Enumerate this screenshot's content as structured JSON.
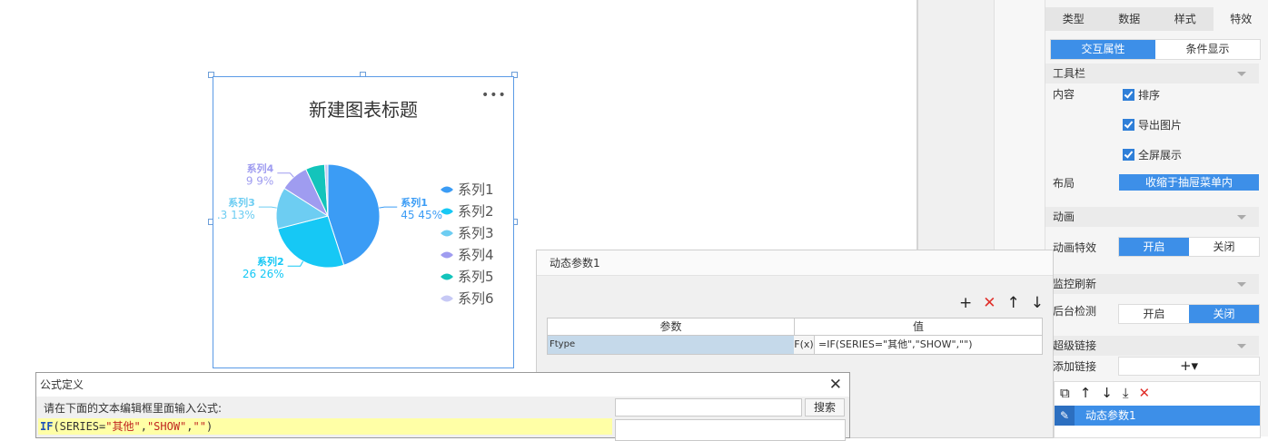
{
  "chart": {
    "title": "新建图表标题",
    "more_glyph": "•••"
  },
  "chart_data": {
    "type": "pie",
    "title": "新建图表标题",
    "series": [
      {
        "name": "系列1",
        "value": 45,
        "percent": "45%",
        "color": "#3b9cf5",
        "label": "系列1",
        "label_value": "45  45%"
      },
      {
        "name": "系列2",
        "value": 26,
        "percent": "26%",
        "color": "#16c8f5",
        "label": "系列2",
        "label_value": "26  26%"
      },
      {
        "name": "系列3",
        "value": 13,
        "percent": "13%",
        "color": "#6dcdf2",
        "label": "系列3",
        "label_value": ".3  13%"
      },
      {
        "name": "系列4",
        "value": 9,
        "percent": "9%",
        "color": "#9f9cf0",
        "label": "系列4",
        "label_value": "9  9%"
      },
      {
        "name": "系列5",
        "value": 6,
        "percent": "6%",
        "color": "#13c4bb",
        "label": "",
        "label_value": ""
      },
      {
        "name": "系列6",
        "value": 1,
        "percent": "1%",
        "color": "#c7c9f5",
        "label": "",
        "label_value": ""
      }
    ],
    "legend": [
      "系列1",
      "系列2",
      "系列3",
      "系列4",
      "系列5",
      "系列6"
    ],
    "legend_position": "right"
  },
  "props": {
    "tabs": [
      "类型",
      "数据",
      "样式",
      "特效"
    ],
    "subtabs": [
      "交互属性",
      "条件显示"
    ],
    "toolbar": {
      "section": "工具栏",
      "content_label": "内容",
      "checks": [
        "排序",
        "导出图片",
        "全屏展示"
      ],
      "layout_label": "布局",
      "layout_value": "收缩于抽屉菜单内"
    },
    "animation": {
      "section": "动画",
      "label": "动画特效",
      "on": "开启",
      "off": "关闭"
    },
    "monitor": {
      "section": "监控刷新",
      "label": "后台检测",
      "on": "开启",
      "off": "关闭"
    },
    "hyperlink": {
      "section": "超级链接",
      "add_label": "添加链接",
      "add_glyph": "+▾",
      "item": "动态参数1"
    }
  },
  "dynamic_param": {
    "title": "动态参数1",
    "col_param": "参数",
    "col_value": "值",
    "row_param": "Ftype",
    "row_fx": "F(x)",
    "row_value": "=IF(SERIES=\"其他\",\"SHOW\",\"\")"
  },
  "formula": {
    "title": "公式定义",
    "prompt": "请在下面的文本编辑框里面输入公式:",
    "kw": "IF",
    "open": "(SERIES=",
    "s1": "\"其他\"",
    "comma1": ",",
    "s2": "\"SHOW\"",
    "comma2": ",",
    "s3": "\"\"",
    "close": ")",
    "search_button": "搜索"
  }
}
